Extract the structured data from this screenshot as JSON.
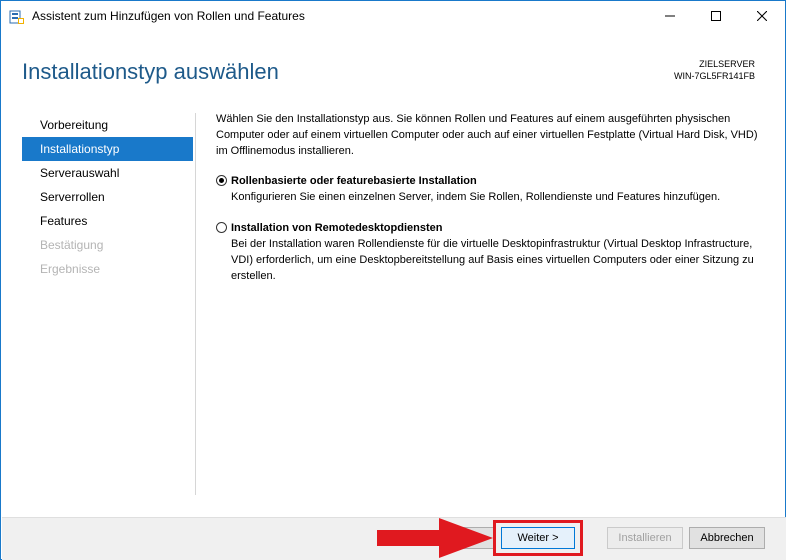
{
  "window": {
    "title": "Assistent zum Hinzufügen von Rollen und Features"
  },
  "header": {
    "title": "Installationstyp auswählen",
    "target_label": "ZIELSERVER",
    "target_name": "WIN-7GL5FR141FB"
  },
  "nav": {
    "items": [
      {
        "label": "Vorbereitung",
        "state": "normal"
      },
      {
        "label": "Installationstyp",
        "state": "active"
      },
      {
        "label": "Serverauswahl",
        "state": "normal"
      },
      {
        "label": "Serverrollen",
        "state": "normal"
      },
      {
        "label": "Features",
        "state": "normal"
      },
      {
        "label": "Bestätigung",
        "state": "disabled"
      },
      {
        "label": "Ergebnisse",
        "state": "disabled"
      }
    ]
  },
  "content": {
    "intro": "Wählen Sie den Installationstyp aus. Sie können Rollen und Features auf einem ausgeführten physischen Computer oder auf einem virtuellen Computer oder auch auf einer virtuellen Festplatte (Virtual Hard Disk, VHD) im Offlinemodus installieren.",
    "options": [
      {
        "title": "Rollenbasierte oder featurebasierte Installation",
        "description": "Konfigurieren Sie einen einzelnen Server, indem Sie Rollen, Rollendienste und Features hinzufügen.",
        "checked": true
      },
      {
        "title": "Installation von Remotedesktopdiensten",
        "description": "Bei der Installation waren Rollendienste für die virtuelle Desktopinfrastruktur (Virtual Desktop Infrastructure, VDI) erforderlich, um eine Desktopbereitstellung auf Basis eines virtuellen Computers oder einer Sitzung zu erstellen.",
        "checked": false
      }
    ]
  },
  "footer": {
    "back_label": "",
    "next_label": "Weiter >",
    "install_label": "Installieren",
    "cancel_label": "Abbrechen"
  },
  "colors": {
    "accent": "#1979ca",
    "title": "#1e5a8a",
    "annotation": "#e0191f"
  }
}
